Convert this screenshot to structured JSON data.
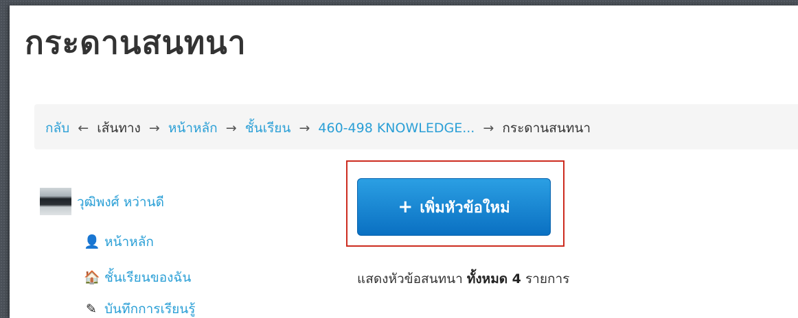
{
  "page": {
    "title": "กระดานสนทนา"
  },
  "breadcrumb": {
    "back": "กลับ",
    "back_arrow": "←",
    "label": "เส้นทาง",
    "sep": "→",
    "items": [
      "หน้าหลัก",
      "ชั้นเรียน",
      "460-498 KNOWLEDGE..."
    ],
    "current": "กระดานสนทนา"
  },
  "sidebar": {
    "user_name": "วุฒิพงศ์ หว่านดี",
    "items": [
      {
        "label": "หน้าหลัก",
        "icon": "user-icon",
        "glyph": "👤"
      },
      {
        "label": "ชั้นเรียนของฉัน",
        "icon": "home-icon",
        "glyph": "🏠"
      },
      {
        "label": "บันทึกการเรียนรู้",
        "icon": "pencil-icon",
        "glyph": "✎"
      }
    ]
  },
  "main": {
    "add_button": {
      "plus": "+",
      "label": "เพิ่มหัวข้อใหม่"
    },
    "summary": {
      "prefix": "แสดงหัวข้อสนทนา",
      "bold": "ทั้งหมด 4",
      "suffix": "รายการ"
    }
  },
  "colors": {
    "link": "#2a9fd6",
    "button": "#1a86d6",
    "highlight": "#cc2a1e"
  }
}
